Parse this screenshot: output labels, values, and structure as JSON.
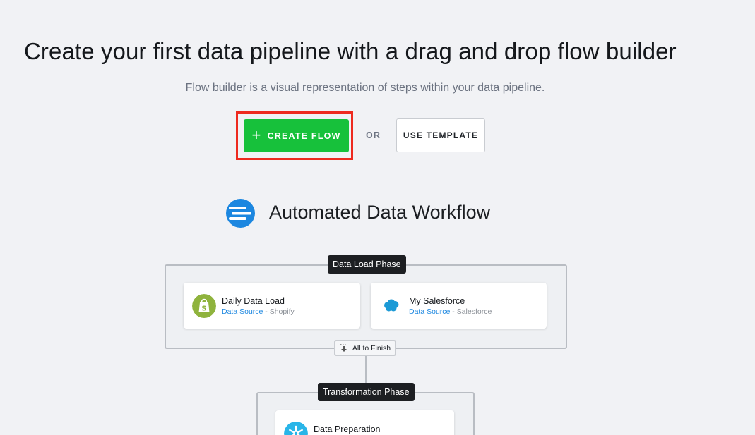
{
  "header": {
    "title": "Create your first data pipeline with a drag and drop flow builder",
    "subtitle": "Flow builder is a visual representation of steps within your data pipeline."
  },
  "actions": {
    "create_flow_label": "CREATE FLOW",
    "or_label": "OR",
    "use_template_label": "USE TEMPLATE"
  },
  "workflow": {
    "title": "Automated Data Workflow",
    "phases": [
      {
        "label": "Data Load Phase",
        "steps": [
          {
            "name": "Daily Data Load",
            "kind": "Data Source",
            "source": "Shopify",
            "icon": "shopify-icon"
          },
          {
            "name": "My Salesforce",
            "kind": "Data Source",
            "source": "Salesforce",
            "icon": "salesforce-icon"
          }
        ]
      },
      {
        "label": "Transformation Phase",
        "steps": [
          {
            "name": "Data Preparation",
            "icon": "snowflake-icon"
          }
        ]
      }
    ],
    "connector_label": "All to Finish",
    "separator": " - "
  },
  "colors": {
    "accent_green": "#17c13b",
    "highlight_red": "#ee2a1f",
    "link_blue": "#1c87e0"
  }
}
